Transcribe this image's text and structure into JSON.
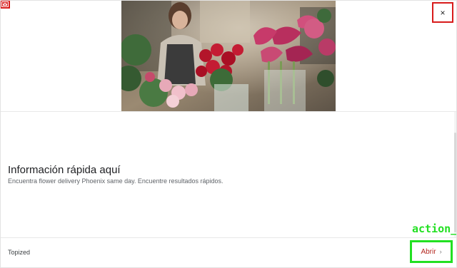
{
  "ad": {
    "headline": "Información rápida aquí",
    "description": "Encuentra flower delivery Phoenix same day. Encuentre resultados rápidos.",
    "advertiser": "Topized",
    "open_button_label": "Abrir",
    "close_symbol": "×",
    "action_label": "action_"
  },
  "icons": {
    "ad_indicator": "ad-choices-icon",
    "close": "close-icon",
    "chevron": "chevron-right-icon"
  },
  "colors": {
    "close_highlight": "#d81b1b",
    "action_highlight": "#22e022",
    "open_button_text": "#b3261e"
  }
}
